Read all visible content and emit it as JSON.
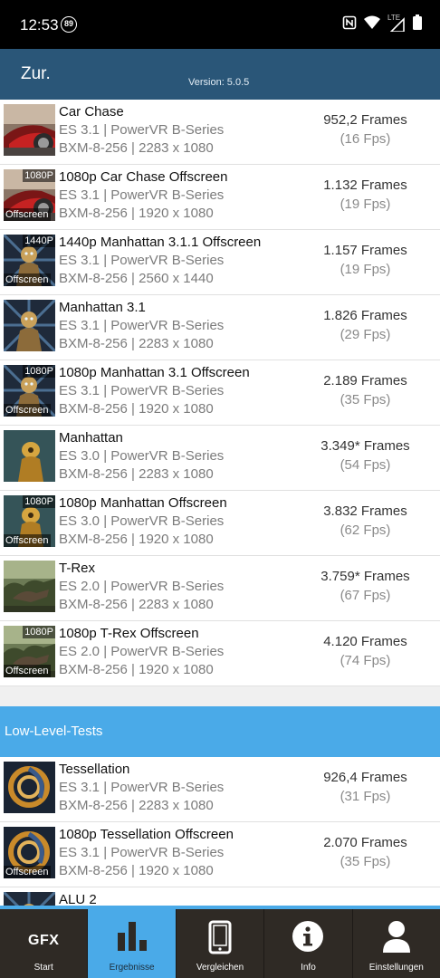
{
  "status_bar": {
    "time": "12:53",
    "badge": "89",
    "network": "LTE"
  },
  "header": {
    "back_label": "Zur.",
    "version": "Version: 5.0.5"
  },
  "tests": [
    {
      "title": "Car Chase",
      "line2": "ES 3.1 | PowerVR B-Series",
      "line3": "BXM-8-256 | 2283 x 1080",
      "frames": "952,2 Frames",
      "fps": "(16 Fps)",
      "tag_top": "",
      "tag_bottom": "",
      "thumb": "car"
    },
    {
      "title": "1080p Car Chase Offscreen",
      "line2": "ES 3.1 | PowerVR B-Series",
      "line3": "BXM-8-256 | 1920 x 1080",
      "frames": "1.132 Frames",
      "fps": "(19 Fps)",
      "tag_top": "1080P",
      "tag_bottom": "Offscreen",
      "thumb": "car"
    },
    {
      "title": "1440p Manhattan 3.1.1 Offscreen",
      "line2": "ES 3.1 | PowerVR B-Series",
      "line3": "BXM-8-256 | 2560 x 1440",
      "frames": "1.157 Frames",
      "fps": "(19 Fps)",
      "tag_top": "1440P",
      "tag_bottom": "Offscreen",
      "thumb": "robot"
    },
    {
      "title": "Manhattan 3.1",
      "line2": "ES 3.1 | PowerVR B-Series",
      "line3": "BXM-8-256 | 2283 x 1080",
      "frames": "1.826 Frames",
      "fps": "(29 Fps)",
      "tag_top": "",
      "tag_bottom": "",
      "thumb": "robot"
    },
    {
      "title": "1080p Manhattan 3.1 Offscreen",
      "line2": "ES 3.1 | PowerVR B-Series",
      "line3": "BXM-8-256 | 1920 x 1080",
      "frames": "2.189 Frames",
      "fps": "(35 Fps)",
      "tag_top": "1080P",
      "tag_bottom": "Offscreen",
      "thumb": "robot"
    },
    {
      "title": "Manhattan",
      "line2": "ES 3.0 | PowerVR B-Series",
      "line3": "BXM-8-256 | 2283 x 1080",
      "frames": "3.349* Frames",
      "fps": "(54 Fps)",
      "tag_top": "",
      "tag_bottom": "",
      "thumb": "mech"
    },
    {
      "title": "1080p Manhattan Offscreen",
      "line2": "ES 3.0 | PowerVR B-Series",
      "line3": "BXM-8-256 | 1920 x 1080",
      "frames": "3.832 Frames",
      "fps": "(62 Fps)",
      "tag_top": "1080P",
      "tag_bottom": "Offscreen",
      "thumb": "mech"
    },
    {
      "title": "T-Rex",
      "line2": "ES 2.0 | PowerVR B-Series",
      "line3": "BXM-8-256 | 2283 x 1080",
      "frames": "3.759* Frames",
      "fps": "(67 Fps)",
      "tag_top": "",
      "tag_bottom": "",
      "thumb": "trex"
    },
    {
      "title": "1080p T-Rex Offscreen",
      "line2": "ES 2.0 | PowerVR B-Series",
      "line3": "BXM-8-256 | 1920 x 1080",
      "frames": "4.120 Frames",
      "fps": "(74 Fps)",
      "tag_top": "1080P",
      "tag_bottom": "Offscreen",
      "thumb": "trex"
    }
  ],
  "low_level_section": {
    "title": "Low-Level-Tests"
  },
  "low_level_tests": [
    {
      "title": "Tessellation",
      "line2": "ES 3.1 | PowerVR B-Series",
      "line3": "BXM-8-256 | 2283 x 1080",
      "frames": "926,4 Frames",
      "fps": "(31 Fps)",
      "tag_top": "",
      "tag_bottom": "",
      "thumb": "tess"
    },
    {
      "title": "1080p Tessellation Offscreen",
      "line2": "ES 3.1 | PowerVR B-Series",
      "line3": "BXM-8-256 | 1920 x 1080",
      "frames": "2.070 Frames",
      "fps": "(35 Fps)",
      "tag_top": "",
      "tag_bottom": "Offscreen",
      "thumb": "tess"
    },
    {
      "title": "ALU 2",
      "line2": "",
      "line3": "",
      "frames": "",
      "fps": "",
      "tag_top": "",
      "tag_bottom": "",
      "thumb": "robot"
    }
  ],
  "bottom_nav": [
    {
      "label": "Start",
      "icon": "gfx-logo",
      "active": false,
      "icon_text": "GFX"
    },
    {
      "label": "Ergebnisse",
      "icon": "bar-chart-icon",
      "active": true
    },
    {
      "label": "Vergleichen",
      "icon": "phone-icon",
      "active": false
    },
    {
      "label": "Info",
      "icon": "info-icon",
      "active": false
    },
    {
      "label": "Einstellungen",
      "icon": "person-icon",
      "active": false
    }
  ],
  "colors": {
    "header": "#2a5678",
    "accent": "#4aaae8",
    "nav_bg": "#2f2a25"
  }
}
